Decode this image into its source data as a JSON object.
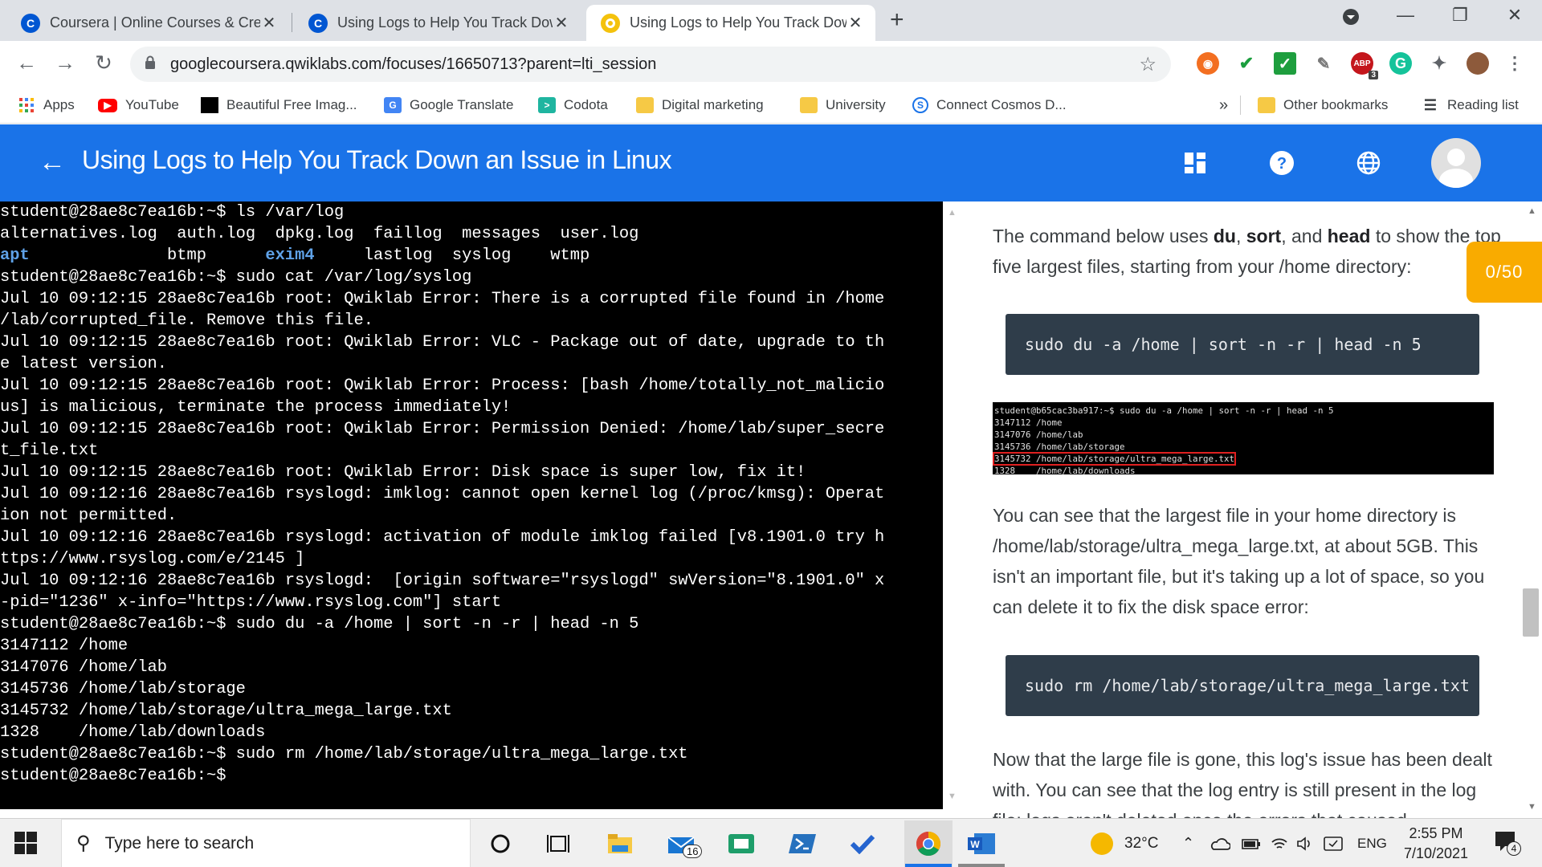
{
  "browser": {
    "tabs": [
      {
        "title": "Coursera | Online Courses & Credentials",
        "favicon": "coursera-icon",
        "active": false
      },
      {
        "title": "Using Logs to Help You Track Down an Issue",
        "favicon": "coursera-icon",
        "active": false
      },
      {
        "title": "Using Logs to Help You Track Down an Issue",
        "favicon": "qwiklabs-icon",
        "active": true
      }
    ],
    "new_tab": "+",
    "url": "googlecoursera.qwiklabs.com/focuses/16650713?parent=lti_session",
    "bookmarks": [
      {
        "label": "Apps",
        "icon": "apps-grid-icon"
      },
      {
        "label": "YouTube",
        "icon": "youtube-icon"
      },
      {
        "label": "Beautiful Free Imag...",
        "icon": "unsplash-icon"
      },
      {
        "label": "Google Translate",
        "icon": "translate-icon"
      },
      {
        "label": "Codota",
        "icon": "codota-icon"
      },
      {
        "label": "Digital marketing",
        "icon": "folder-icon"
      },
      {
        "label": "University",
        "icon": "folder-icon"
      },
      {
        "label": "Connect Cosmos D...",
        "icon": "cosmos-icon"
      }
    ],
    "overflow": "»",
    "other_bookmarks": "Other bookmarks",
    "reading_list": "Reading list",
    "extension_badges": {
      "abp": "3"
    }
  },
  "app": {
    "title": "Using Logs to Help You Track Down an Issue in Linux",
    "brand_color": "#1a73e8"
  },
  "terminal": {
    "lines": [
      "student@28ae8c7ea16b:~$ ls /var/log",
      "alternatives.log  auth.log  dpkg.log  faillog  messages  user.log",
      "__APT_LINE__",
      "student@28ae8c7ea16b:~$ sudo cat /var/log/syslog",
      "Jul 10 09:12:15 28ae8c7ea16b root: Qwiklab Error: There is a corrupted file found in /home",
      "/lab/corrupted_file. Remove this file.",
      "Jul 10 09:12:15 28ae8c7ea16b root: Qwiklab Error: VLC - Package out of date, upgrade to th",
      "e latest version.",
      "Jul 10 09:12:15 28ae8c7ea16b root: Qwiklab Error: Process: [bash /home/totally_not_malicio",
      "us] is malicious, terminate the process immediately!",
      "Jul 10 09:12:15 28ae8c7ea16b root: Qwiklab Error: Permission Denied: /home/lab/super_secre",
      "t_file.txt",
      "Jul 10 09:12:15 28ae8c7ea16b root: Qwiklab Error: Disk space is super low, fix it!",
      "Jul 10 09:12:16 28ae8c7ea16b rsyslogd: imklog: cannot open kernel log (/proc/kmsg): Operat",
      "ion not permitted.",
      "Jul 10 09:12:16 28ae8c7ea16b rsyslogd: activation of module imklog failed [v8.1901.0 try h",
      "ttps://www.rsyslog.com/e/2145 ]",
      "Jul 10 09:12:16 28ae8c7ea16b rsyslogd:  [origin software=\"rsyslogd\" swVersion=\"8.1901.0\" x",
      "-pid=\"1236\" x-info=\"https://www.rsyslog.com\"] start",
      "student@28ae8c7ea16b:~$ sudo du -a /home | sort -n -r | head -n 5",
      "3147112 /home",
      "3147076 /home/lab",
      "3145736 /home/lab/storage",
      "3145732 /home/lab/storage/ultra_mega_large.txt",
      "1328    /home/lab/downloads",
      "student@28ae8c7ea16b:~$ sudo rm /home/lab/storage/ultra_mega_large.txt",
      "student@28ae8c7ea16b:~$ "
    ],
    "apt_row": {
      "apt": "apt",
      "mid1": "              btmp      ",
      "exim4": "exim4",
      "rest": "     lastlog  syslog    wtmp"
    }
  },
  "lab": {
    "intro_pre": "The command below uses ",
    "du": "du",
    "comma": ", ",
    "sort": "sort",
    "and": ", and ",
    "head": "head",
    "intro_post": " to show the top five largest files, starting from your /home directory:",
    "code1": "sudo du -a /home | sort -n -r | head -n 5",
    "screenshot_lines": [
      "student@b65cac3ba917:~$ sudo du -a /home | sort -n -r | head -n 5",
      "3147112 /home",
      "3147076 /home/lab",
      "3145736 /home/lab/storage",
      "3145732 /home/lab/storage/ultra_mega_large.txt",
      "1328    /home/lab/downloads"
    ],
    "para2": "You can see that the largest file in your home directory is /home/lab/storage/ultra_mega_large.txt, at about 5GB. This isn't an important file, but it's taking up a lot of space, so you can delete it to fix the disk space error:",
    "code2": "sudo rm /home/lab/storage/ultra_mega_large.txt",
    "para3": "Now that the large file is gone, this log's issue has been dealt with. You can see that the log entry is still present in the log file; logs aren't deleted once the errors that caused",
    "score": "0/50",
    "score_color": "#f9ab00"
  },
  "taskbar": {
    "search_placeholder": "Type here to search",
    "mail_badge": "16",
    "weather_temp": "32°C",
    "language": "ENG",
    "time": "2:55 PM",
    "date": "7/10/2021",
    "notification_count": "4"
  }
}
